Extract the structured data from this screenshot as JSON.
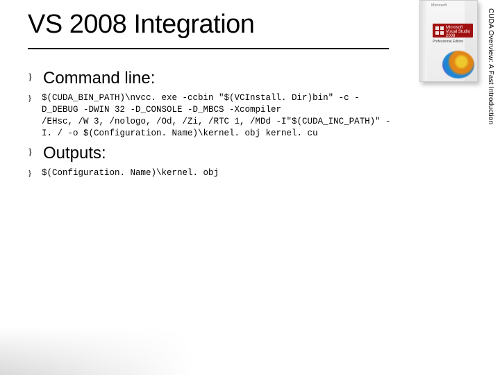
{
  "title": "VS 2008 Integration",
  "side_label": "CUDA Overview: A Fast Introduction",
  "box": {
    "vendor": "Microsoft",
    "brand_top": "Microsoft",
    "brand_main": "Visual Studio 2008",
    "edition": "Professional Edition"
  },
  "bullets": {
    "b1": {
      "label": "Command line:"
    },
    "b2": {
      "code": "$(CUDA_BIN_PATH)\\nvcc. exe -ccbin \"$(VCInstall. Dir)bin\" -c -\nD_DEBUG -DWIN 32 -D_CONSOLE -D_MBCS -Xcompiler\n/EHsc, /W 3, /nologo, /Od, /Zi, /RTC 1, /MDd -I\"$(CUDA_INC_PATH)\" -\nI. / -o $(Configuration. Name)\\kernel. obj kernel. cu"
    },
    "b3": {
      "label": "Outputs:"
    },
    "b4": {
      "code": "$(Configuration. Name)\\kernel. obj"
    }
  }
}
